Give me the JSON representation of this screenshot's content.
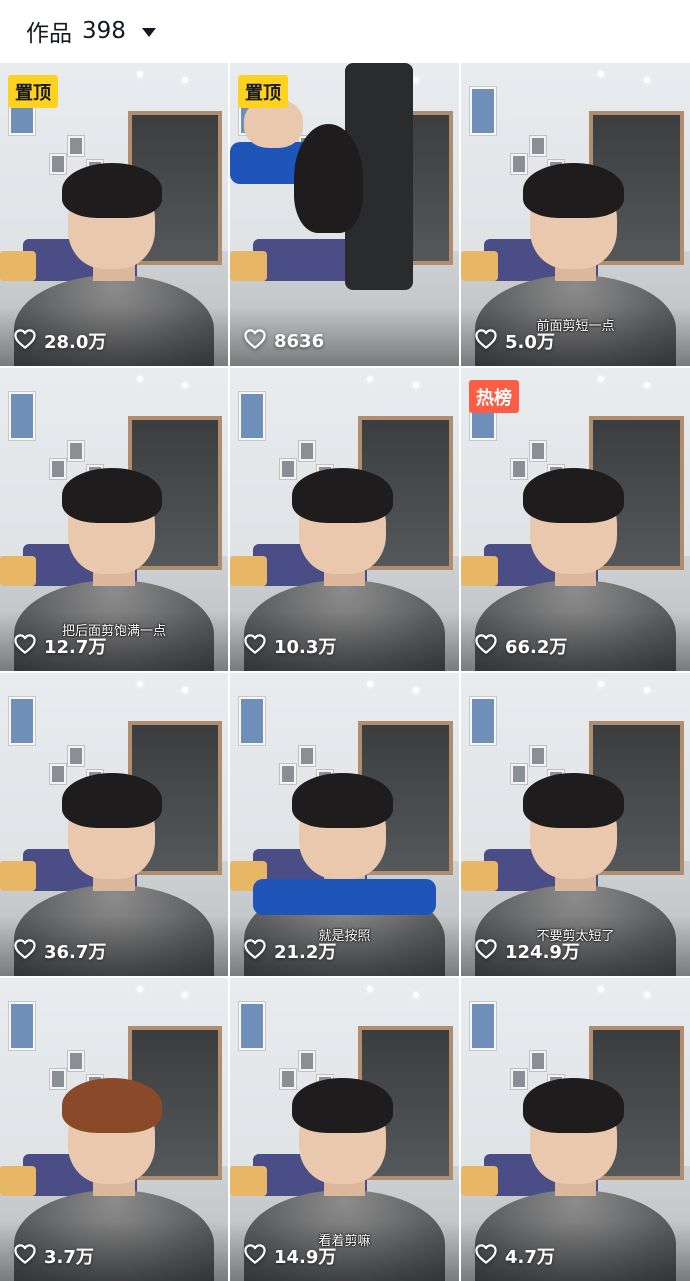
{
  "header": {
    "label": "作品",
    "count": "398"
  },
  "icons": {
    "like": "heart-outline-icon",
    "dropdown": "caret-down-icon"
  },
  "colors": {
    "pin_badge": "#ffd21f",
    "hot_badge": "#fe5d45"
  },
  "videos": [
    {
      "badge": "置顶",
      "badge_type": "pin",
      "likes": "28.0万",
      "subtitle": ""
    },
    {
      "badge": "置顶",
      "badge_type": "pin",
      "likes": "8636",
      "subtitle": ""
    },
    {
      "badge": "",
      "badge_type": "",
      "likes": "5.0万",
      "subtitle": "前面剪短一点"
    },
    {
      "badge": "",
      "badge_type": "",
      "likes": "12.7万",
      "subtitle": "把后面剪饱满一点"
    },
    {
      "badge": "",
      "badge_type": "",
      "likes": "10.3万",
      "subtitle": ""
    },
    {
      "badge": "热榜",
      "badge_type": "hot",
      "likes": "66.2万",
      "subtitle": ""
    },
    {
      "badge": "",
      "badge_type": "",
      "likes": "36.7万",
      "subtitle": ""
    },
    {
      "badge": "",
      "badge_type": "",
      "likes": "21.2万",
      "subtitle": "就是按照"
    },
    {
      "badge": "",
      "badge_type": "",
      "likes": "124.9万",
      "subtitle": "不要剪太短了"
    },
    {
      "badge": "",
      "badge_type": "",
      "likes": "3.7万",
      "subtitle": ""
    },
    {
      "badge": "",
      "badge_type": "",
      "likes": "14.9万",
      "subtitle": "看着剪嘛"
    },
    {
      "badge": "",
      "badge_type": "",
      "likes": "4.7万",
      "subtitle": ""
    }
  ]
}
